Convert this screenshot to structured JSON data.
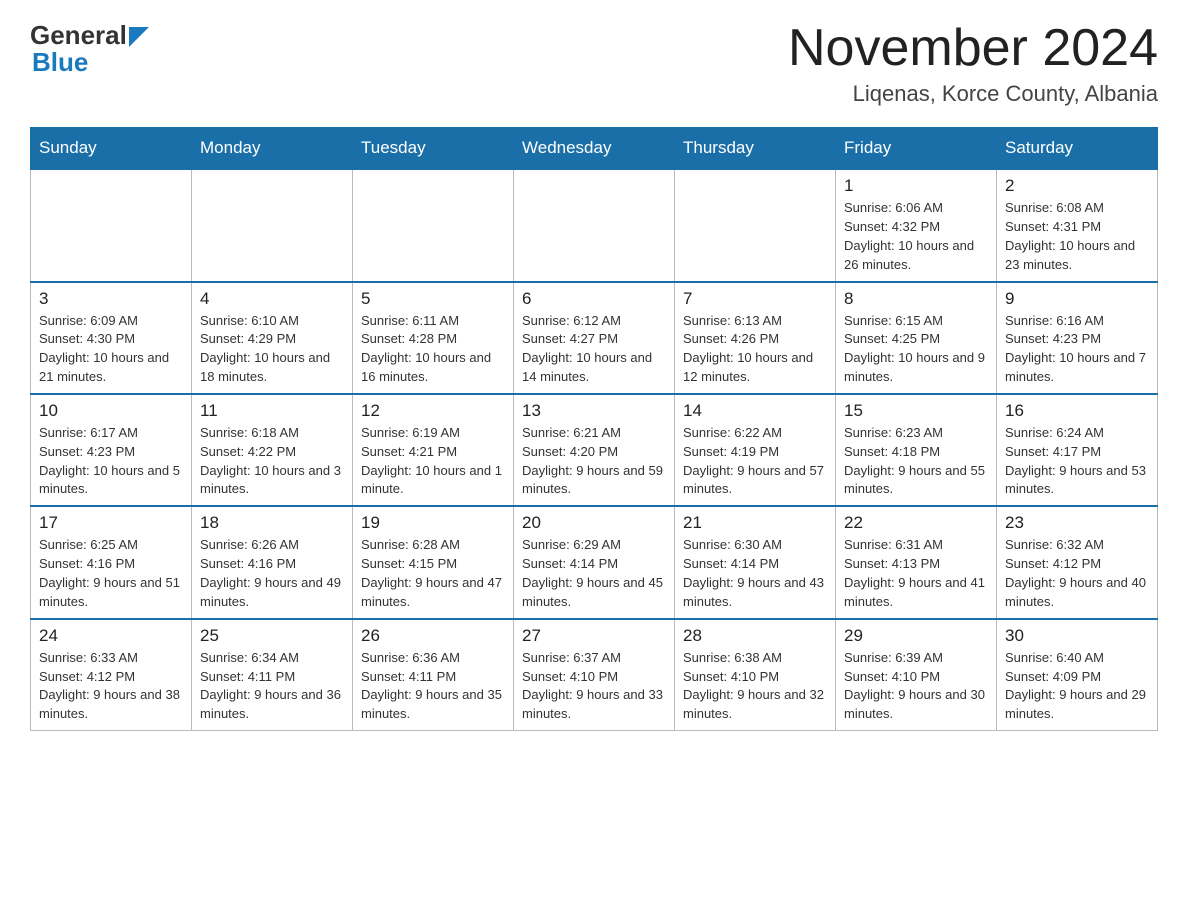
{
  "header": {
    "logo": {
      "general": "General",
      "blue": "Blue",
      "arrow_color": "#1a7abf"
    },
    "title": "November 2024",
    "location": "Liqenas, Korce County, Albania"
  },
  "calendar": {
    "days_of_week": [
      "Sunday",
      "Monday",
      "Tuesday",
      "Wednesday",
      "Thursday",
      "Friday",
      "Saturday"
    ],
    "weeks": [
      [
        {
          "day": "",
          "info": ""
        },
        {
          "day": "",
          "info": ""
        },
        {
          "day": "",
          "info": ""
        },
        {
          "day": "",
          "info": ""
        },
        {
          "day": "",
          "info": ""
        },
        {
          "day": "1",
          "info": "Sunrise: 6:06 AM\nSunset: 4:32 PM\nDaylight: 10 hours and 26 minutes."
        },
        {
          "day": "2",
          "info": "Sunrise: 6:08 AM\nSunset: 4:31 PM\nDaylight: 10 hours and 23 minutes."
        }
      ],
      [
        {
          "day": "3",
          "info": "Sunrise: 6:09 AM\nSunset: 4:30 PM\nDaylight: 10 hours and 21 minutes."
        },
        {
          "day": "4",
          "info": "Sunrise: 6:10 AM\nSunset: 4:29 PM\nDaylight: 10 hours and 18 minutes."
        },
        {
          "day": "5",
          "info": "Sunrise: 6:11 AM\nSunset: 4:28 PM\nDaylight: 10 hours and 16 minutes."
        },
        {
          "day": "6",
          "info": "Sunrise: 6:12 AM\nSunset: 4:27 PM\nDaylight: 10 hours and 14 minutes."
        },
        {
          "day": "7",
          "info": "Sunrise: 6:13 AM\nSunset: 4:26 PM\nDaylight: 10 hours and 12 minutes."
        },
        {
          "day": "8",
          "info": "Sunrise: 6:15 AM\nSunset: 4:25 PM\nDaylight: 10 hours and 9 minutes."
        },
        {
          "day": "9",
          "info": "Sunrise: 6:16 AM\nSunset: 4:23 PM\nDaylight: 10 hours and 7 minutes."
        }
      ],
      [
        {
          "day": "10",
          "info": "Sunrise: 6:17 AM\nSunset: 4:23 PM\nDaylight: 10 hours and 5 minutes."
        },
        {
          "day": "11",
          "info": "Sunrise: 6:18 AM\nSunset: 4:22 PM\nDaylight: 10 hours and 3 minutes."
        },
        {
          "day": "12",
          "info": "Sunrise: 6:19 AM\nSunset: 4:21 PM\nDaylight: 10 hours and 1 minute."
        },
        {
          "day": "13",
          "info": "Sunrise: 6:21 AM\nSunset: 4:20 PM\nDaylight: 9 hours and 59 minutes."
        },
        {
          "day": "14",
          "info": "Sunrise: 6:22 AM\nSunset: 4:19 PM\nDaylight: 9 hours and 57 minutes."
        },
        {
          "day": "15",
          "info": "Sunrise: 6:23 AM\nSunset: 4:18 PM\nDaylight: 9 hours and 55 minutes."
        },
        {
          "day": "16",
          "info": "Sunrise: 6:24 AM\nSunset: 4:17 PM\nDaylight: 9 hours and 53 minutes."
        }
      ],
      [
        {
          "day": "17",
          "info": "Sunrise: 6:25 AM\nSunset: 4:16 PM\nDaylight: 9 hours and 51 minutes."
        },
        {
          "day": "18",
          "info": "Sunrise: 6:26 AM\nSunset: 4:16 PM\nDaylight: 9 hours and 49 minutes."
        },
        {
          "day": "19",
          "info": "Sunrise: 6:28 AM\nSunset: 4:15 PM\nDaylight: 9 hours and 47 minutes."
        },
        {
          "day": "20",
          "info": "Sunrise: 6:29 AM\nSunset: 4:14 PM\nDaylight: 9 hours and 45 minutes."
        },
        {
          "day": "21",
          "info": "Sunrise: 6:30 AM\nSunset: 4:14 PM\nDaylight: 9 hours and 43 minutes."
        },
        {
          "day": "22",
          "info": "Sunrise: 6:31 AM\nSunset: 4:13 PM\nDaylight: 9 hours and 41 minutes."
        },
        {
          "day": "23",
          "info": "Sunrise: 6:32 AM\nSunset: 4:12 PM\nDaylight: 9 hours and 40 minutes."
        }
      ],
      [
        {
          "day": "24",
          "info": "Sunrise: 6:33 AM\nSunset: 4:12 PM\nDaylight: 9 hours and 38 minutes."
        },
        {
          "day": "25",
          "info": "Sunrise: 6:34 AM\nSunset: 4:11 PM\nDaylight: 9 hours and 36 minutes."
        },
        {
          "day": "26",
          "info": "Sunrise: 6:36 AM\nSunset: 4:11 PM\nDaylight: 9 hours and 35 minutes."
        },
        {
          "day": "27",
          "info": "Sunrise: 6:37 AM\nSunset: 4:10 PM\nDaylight: 9 hours and 33 minutes."
        },
        {
          "day": "28",
          "info": "Sunrise: 6:38 AM\nSunset: 4:10 PM\nDaylight: 9 hours and 32 minutes."
        },
        {
          "day": "29",
          "info": "Sunrise: 6:39 AM\nSunset: 4:10 PM\nDaylight: 9 hours and 30 minutes."
        },
        {
          "day": "30",
          "info": "Sunrise: 6:40 AM\nSunset: 4:09 PM\nDaylight: 9 hours and 29 minutes."
        }
      ]
    ]
  }
}
